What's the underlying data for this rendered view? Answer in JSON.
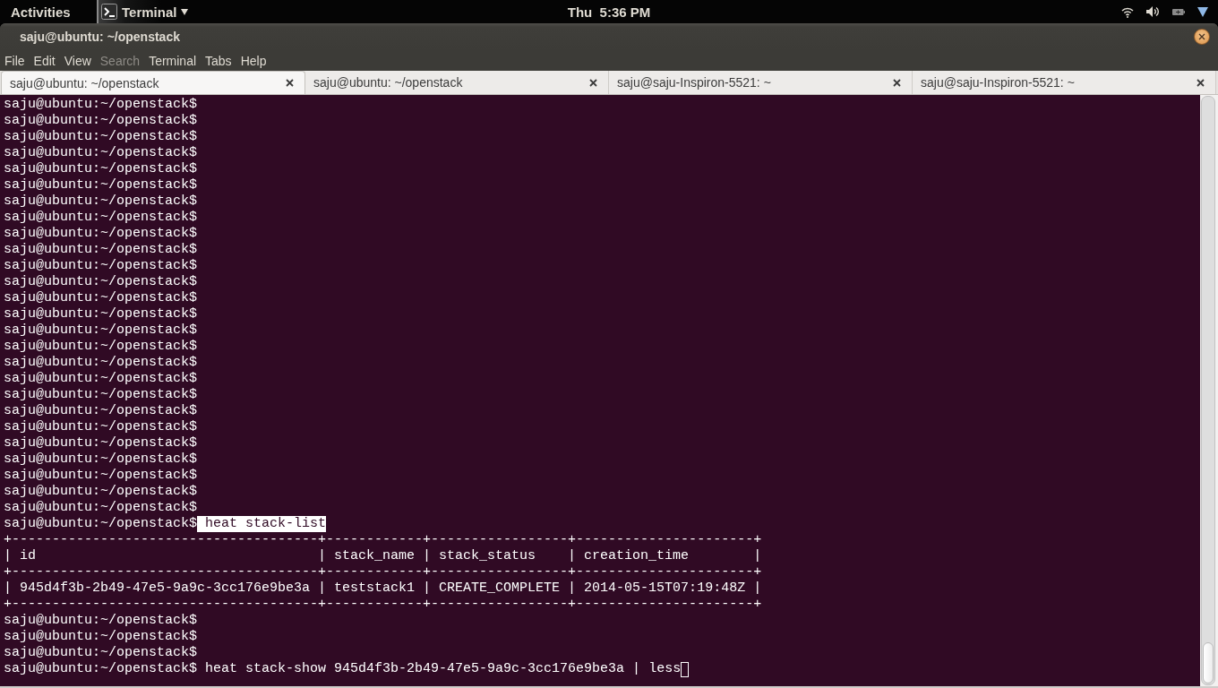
{
  "top_panel": {
    "activities": "Activities",
    "app_menu": "Terminal",
    "clock": "Thu  5:36 PM"
  },
  "window": {
    "title": "saju@ubuntu: ~/openstack"
  },
  "menu": [
    {
      "label": "File",
      "disabled": false
    },
    {
      "label": "Edit",
      "disabled": false
    },
    {
      "label": "View",
      "disabled": false
    },
    {
      "label": "Search",
      "disabled": true
    },
    {
      "label": "Terminal",
      "disabled": false
    },
    {
      "label": "Tabs",
      "disabled": false
    },
    {
      "label": "Help",
      "disabled": false
    }
  ],
  "tabs": [
    {
      "label": "saju@ubuntu: ~/openstack",
      "selected": true
    },
    {
      "label": "saju@ubuntu: ~/openstack",
      "selected": false
    },
    {
      "label": "saju@saju-Inspiron-5521: ~",
      "selected": false
    },
    {
      "label": "saju@saju-Inspiron-5521: ~",
      "selected": false
    }
  ],
  "terminal": {
    "lines": [
      {
        "kind": "prompt",
        "prompt": "saju@ubuntu:~/openstack$"
      },
      {
        "kind": "prompt",
        "prompt": "saju@ubuntu:~/openstack$"
      },
      {
        "kind": "prompt",
        "prompt": "saju@ubuntu:~/openstack$"
      },
      {
        "kind": "prompt",
        "prompt": "saju@ubuntu:~/openstack$"
      },
      {
        "kind": "prompt",
        "prompt": "saju@ubuntu:~/openstack$"
      },
      {
        "kind": "prompt",
        "prompt": "saju@ubuntu:~/openstack$"
      },
      {
        "kind": "prompt",
        "prompt": "saju@ubuntu:~/openstack$"
      },
      {
        "kind": "prompt",
        "prompt": "saju@ubuntu:~/openstack$"
      },
      {
        "kind": "prompt",
        "prompt": "saju@ubuntu:~/openstack$"
      },
      {
        "kind": "prompt",
        "prompt": "saju@ubuntu:~/openstack$"
      },
      {
        "kind": "prompt",
        "prompt": "saju@ubuntu:~/openstack$"
      },
      {
        "kind": "prompt",
        "prompt": "saju@ubuntu:~/openstack$"
      },
      {
        "kind": "prompt",
        "prompt": "saju@ubuntu:~/openstack$"
      },
      {
        "kind": "prompt",
        "prompt": "saju@ubuntu:~/openstack$"
      },
      {
        "kind": "prompt",
        "prompt": "saju@ubuntu:~/openstack$"
      },
      {
        "kind": "prompt",
        "prompt": "saju@ubuntu:~/openstack$"
      },
      {
        "kind": "prompt",
        "prompt": "saju@ubuntu:~/openstack$"
      },
      {
        "kind": "prompt",
        "prompt": "saju@ubuntu:~/openstack$"
      },
      {
        "kind": "prompt",
        "prompt": "saju@ubuntu:~/openstack$"
      },
      {
        "kind": "prompt",
        "prompt": "saju@ubuntu:~/openstack$"
      },
      {
        "kind": "prompt",
        "prompt": "saju@ubuntu:~/openstack$"
      },
      {
        "kind": "prompt",
        "prompt": "saju@ubuntu:~/openstack$"
      },
      {
        "kind": "prompt",
        "prompt": "saju@ubuntu:~/openstack$"
      },
      {
        "kind": "prompt",
        "prompt": "saju@ubuntu:~/openstack$"
      },
      {
        "kind": "prompt",
        "prompt": "saju@ubuntu:~/openstack$"
      },
      {
        "kind": "prompt",
        "prompt": "saju@ubuntu:~/openstack$"
      },
      {
        "kind": "prompt",
        "prompt": "saju@ubuntu:~/openstack$",
        "command": "heat stack-list",
        "highlighted": true
      },
      {
        "kind": "output",
        "text": "+--------------------------------------+------------+-----------------+----------------------+"
      },
      {
        "kind": "output",
        "text": "| id                                   | stack_name | stack_status    | creation_time        |"
      },
      {
        "kind": "output",
        "text": "+--------------------------------------+------------+-----------------+----------------------+"
      },
      {
        "kind": "output",
        "text": "| 945d4f3b-2b49-47e5-9a9c-3cc176e9be3a | teststack1 | CREATE_COMPLETE | 2014-05-15T07:19:48Z |"
      },
      {
        "kind": "output",
        "text": "+--------------------------------------+------------+-----------------+----------------------+"
      },
      {
        "kind": "prompt",
        "prompt": "saju@ubuntu:~/openstack$"
      },
      {
        "kind": "prompt",
        "prompt": "saju@ubuntu:~/openstack$"
      },
      {
        "kind": "prompt",
        "prompt": "saju@ubuntu:~/openstack$"
      },
      {
        "kind": "prompt",
        "prompt": "saju@ubuntu:~/openstack$",
        "command": "heat stack-show 945d4f3b-2b49-47e5-9a9c-3cc176e9be3a | less",
        "highlighted": false,
        "cursor": true
      }
    ]
  }
}
